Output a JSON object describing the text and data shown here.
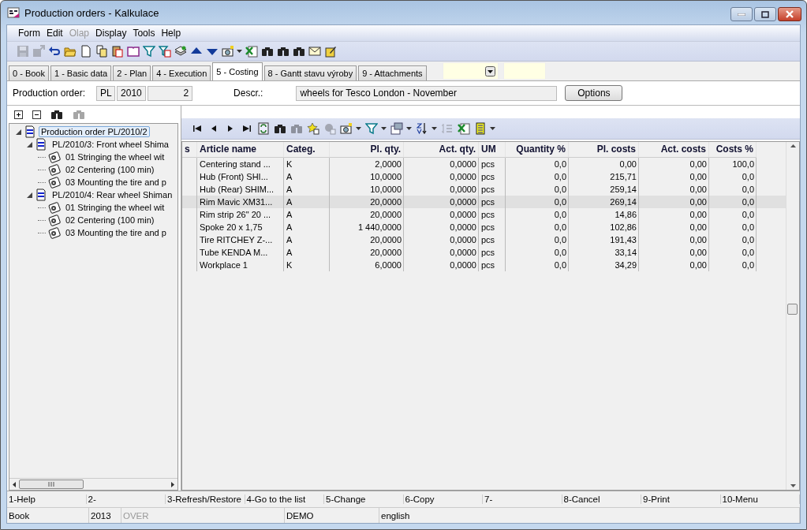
{
  "window": {
    "title": "Production orders - Kalkulace"
  },
  "menu": [
    {
      "label": "Form",
      "disabled": false
    },
    {
      "label": "Edit",
      "disabled": false
    },
    {
      "label": "Olap",
      "disabled": true
    },
    {
      "label": "Display",
      "disabled": false
    },
    {
      "label": "Tools",
      "disabled": false
    },
    {
      "label": "Help",
      "disabled": false
    }
  ],
  "tabs": [
    {
      "label": "0 - Book",
      "selected": false
    },
    {
      "label": "1 - Basic data",
      "selected": false
    },
    {
      "label": "2 - Plan",
      "selected": false
    },
    {
      "label": "4 - Execution",
      "selected": false
    },
    {
      "label": "5 - Costing",
      "selected": true
    },
    {
      "label": "8 - Gantt stavu výroby",
      "selected": false
    },
    {
      "label": "9 - Attachments",
      "selected": false
    }
  ],
  "header": {
    "order_label": "Production order:",
    "order_fields": [
      "PL",
      "2010",
      "2"
    ],
    "descr_label": "Descr.:",
    "descr_value": "wheels for Tesco London - November",
    "options_button": "Options"
  },
  "tree": {
    "items": [
      {
        "label": "Production order PL/2010/2",
        "kind": "order",
        "selected": true,
        "expanded": true,
        "children": [
          {
            "label": "PL/2010/3: Front wheel Shima",
            "kind": "order",
            "selected": false,
            "expanded": true,
            "children": [
              {
                "label": "01 Stringing the wheel wit",
                "kind": "operation",
                "selected": false
              },
              {
                "label": "02 Centering (100 min)",
                "kind": "operation",
                "selected": false
              },
              {
                "label": "03 Mounting the tire and p",
                "kind": "operation",
                "selected": false
              }
            ]
          },
          {
            "label": "PL/2010/4: Rear wheel Shiman",
            "kind": "order",
            "selected": false,
            "expanded": true,
            "children": [
              {
                "label": "01 Stringing the wheel wit",
                "kind": "operation",
                "selected": false
              },
              {
                "label": "02 Centering (100 min)",
                "kind": "operation",
                "selected": false
              },
              {
                "label": "03 Mounting the tire and p",
                "kind": "operation",
                "selected": false
              }
            ]
          }
        ]
      }
    ]
  },
  "grid": {
    "columns": [
      "s",
      "Article name",
      "Categ.",
      "Pl. qty.",
      "Act. qty.",
      "UM",
      "Quantity %",
      "Pl. costs",
      "Act. costs",
      "Costs %"
    ],
    "rows": [
      {
        "selected": false,
        "cells": [
          "",
          "Centering stand ...",
          "K",
          "2,0000",
          "0,0000",
          "pcs",
          "0,0",
          "0,00",
          "0,00",
          "100,0"
        ]
      },
      {
        "selected": false,
        "cells": [
          "",
          "Hub (Front) SHI...",
          "A",
          "10,0000",
          "0,0000",
          "pcs",
          "0,0",
          "215,71",
          "0,00",
          "0,0"
        ]
      },
      {
        "selected": false,
        "cells": [
          "",
          "Hub (Rear) SHIM...",
          "A",
          "10,0000",
          "0,0000",
          "pcs",
          "0,0",
          "259,14",
          "0,00",
          "0,0"
        ]
      },
      {
        "selected": true,
        "cells": [
          "",
          "Rim Mavic XM31...",
          "A",
          "20,0000",
          "0,0000",
          "pcs",
          "0,0",
          "269,14",
          "0,00",
          "0,0"
        ]
      },
      {
        "selected": false,
        "cells": [
          "",
          "Rim strip 26\" 20 ...",
          "A",
          "20,0000",
          "0,0000",
          "pcs",
          "0,0",
          "14,86",
          "0,00",
          "0,0"
        ]
      },
      {
        "selected": false,
        "cells": [
          "",
          "Spoke 20 x 1,75",
          "A",
          "1 440,0000",
          "0,0000",
          "pcs",
          "0,0",
          "102,86",
          "0,00",
          "0,0"
        ]
      },
      {
        "selected": false,
        "cells": [
          "",
          "Tire RITCHEY Z-...",
          "A",
          "20,0000",
          "0,0000",
          "pcs",
          "0,0",
          "191,43",
          "0,00",
          "0,0"
        ]
      },
      {
        "selected": false,
        "cells": [
          "",
          "Tube KENDA M...",
          "A",
          "20,0000",
          "0,0000",
          "pcs",
          "0,0",
          "33,14",
          "0,00",
          "0,0"
        ]
      },
      {
        "selected": false,
        "cells": [
          "",
          "Workplace 1",
          "K",
          "6,0000",
          "0,0000",
          "pcs",
          "0,0",
          "34,29",
          "0,00",
          "0,0"
        ]
      }
    ]
  },
  "function_keys": [
    "1-Help",
    "2-",
    "3-Refresh/Restore",
    "4-Go to the list",
    "5-Change",
    "6-Copy",
    "7-",
    "8-Cancel",
    "9-Print",
    "10-Menu"
  ],
  "status_bar": [
    {
      "text": "Book",
      "disabled": false
    },
    {
      "text": "2013",
      "disabled": false
    },
    {
      "text": "OVER",
      "disabled": true
    },
    {
      "text": "DEMO",
      "disabled": false
    },
    {
      "text": "english",
      "disabled": false
    }
  ]
}
